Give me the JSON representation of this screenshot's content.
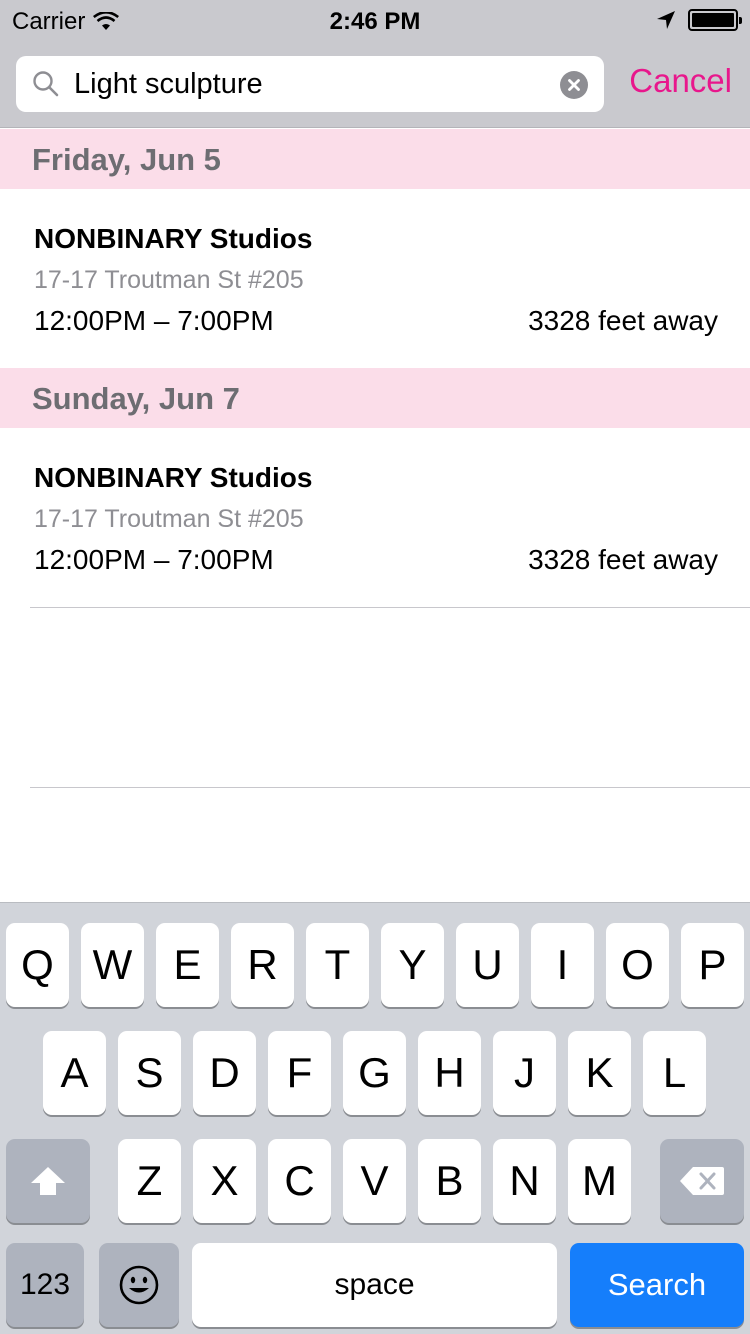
{
  "status_bar": {
    "carrier": "Carrier",
    "time": "2:46 PM",
    "battery_level": 1.0
  },
  "search": {
    "value": "Light sculpture",
    "cancel_label": "Cancel"
  },
  "sections": [
    {
      "header": "Friday, Jun 5",
      "items": [
        {
          "title": "NONBINARY Studios",
          "address": "17-17 Troutman St #205",
          "hours": "12:00PM – 7:00PM",
          "distance": "3328 feet away"
        }
      ]
    },
    {
      "header": "Sunday, Jun 7",
      "items": [
        {
          "title": "NONBINARY Studios",
          "address": "17-17 Troutman St #205",
          "hours": "12:00PM – 7:00PM",
          "distance": "3328 feet away"
        }
      ]
    }
  ],
  "keyboard": {
    "row1": [
      "Q",
      "W",
      "E",
      "R",
      "T",
      "Y",
      "U",
      "I",
      "O",
      "P"
    ],
    "row2": [
      "A",
      "S",
      "D",
      "F",
      "G",
      "H",
      "J",
      "K",
      "L"
    ],
    "row3": [
      "Z",
      "X",
      "C",
      "V",
      "B",
      "N",
      "M"
    ],
    "numbers_label": "123",
    "space_label": "space",
    "search_label": "Search"
  },
  "colors": {
    "accent": "#e8178c",
    "section_bg": "#fbdde9",
    "search_key": "#157efb"
  },
  "icons": [
    "wifi-icon",
    "location-arrow-icon",
    "battery-icon",
    "search-icon",
    "clear-icon",
    "shift-icon",
    "emoji-icon",
    "delete-icon"
  ]
}
